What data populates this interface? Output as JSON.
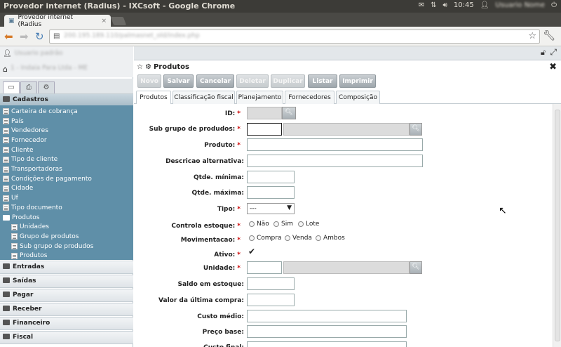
{
  "window": {
    "title": "Provedor internet (Radius) - IXCsoft - Google Chrome"
  },
  "tray": {
    "clock": "10:45",
    "user": "Usuario Nome"
  },
  "browser": {
    "tab_title": "Provedor internet (Radius",
    "tab_close": "×",
    "url": "200.195.189.110/palmasnet_old/index.php",
    "star": "☆"
  },
  "left": {
    "user_name": "Usuario padrão",
    "company": "1 - Indaia Para Ltda - ME",
    "sections": {
      "cadastros": "Cadastros",
      "entradas": "Entradas",
      "saidas": "Saídas",
      "pagar": "Pagar",
      "receber": "Receber",
      "financeiro": "Financeiro",
      "fiscal": "Fiscal"
    },
    "items": [
      "Carteira de cobrança",
      "País",
      "Vendedores",
      "Fornecedor",
      "Cliente",
      "Tipo de cliente",
      "Transportadoras",
      "Condições de pagamento",
      "Cidade",
      "Uf",
      "Tipo documento",
      "Produtos",
      "Unidades",
      "Grupo de produtos",
      "Sub grupo de produdos",
      "Produtos"
    ]
  },
  "window_panel": {
    "title": "Produtos",
    "close": "✖"
  },
  "buttons": {
    "novo": "Novo",
    "salvar": "Salvar",
    "cancelar": "Cancelar",
    "deletar": "Deletar",
    "duplicar": "Duplicar",
    "listar": "Listar",
    "imprimir": "Imprimir"
  },
  "tabs": {
    "produtos": "Produtos",
    "classificacao": "Classificação fiscal",
    "planejamento": "Planejamento",
    "fornecedores": "Fornecedores",
    "composicao": "Composição"
  },
  "form": {
    "required_mark": "*",
    "id": "ID:",
    "subgrupo": "Sub grupo de produdos:",
    "produto": "Produto:",
    "descricao": "Descricao alternativa:",
    "qtde_min": "Qtde. mínima:",
    "qtde_max": "Qtde. máxima:",
    "tipo": "Tipo:",
    "tipo_value": "---",
    "controla": "Controla estoque:",
    "controla_opts": [
      "Não",
      "Sim",
      "Lote"
    ],
    "movimentacao": "Movimentacao:",
    "mov_opts": [
      "Compra",
      "Venda",
      "Ambos"
    ],
    "ativo": "Ativo:",
    "unidade": "Unidade:",
    "saldo": "Saldo em estoque:",
    "valor_ult": "Valor da última compra:",
    "custo": "Custo médio:",
    "preco": "Preço base:",
    "cut_label": "Custo final:"
  }
}
